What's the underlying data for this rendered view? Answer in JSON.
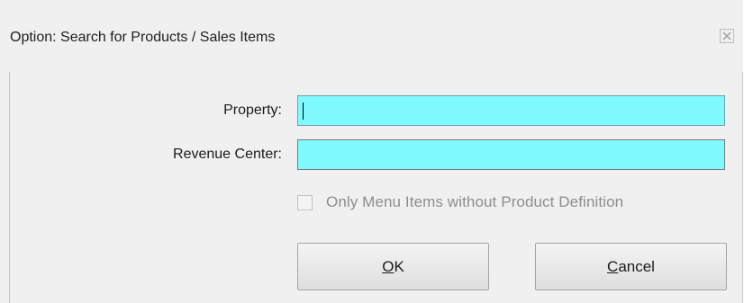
{
  "dialog": {
    "title": "Option: Search for Products / Sales Items",
    "close_icon": "close-icon"
  },
  "form": {
    "property_label": "Property:",
    "property_value": "",
    "revenue_center_label": "Revenue Center:",
    "revenue_center_value": "",
    "field_color": "#7ffbff",
    "checkbox_label": "Only Menu Items without Product Definition",
    "checkbox_checked": false,
    "checkbox_enabled": false
  },
  "buttons": {
    "ok_mnemonic": "O",
    "ok_rest": "K",
    "cancel_mnemonic": "C",
    "cancel_rest": "ancel"
  }
}
